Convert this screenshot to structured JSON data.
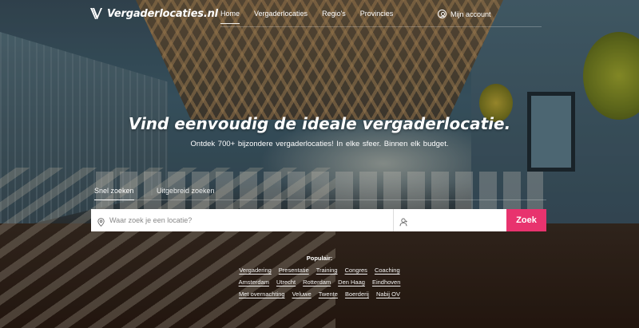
{
  "header": {
    "logo_text": "Vergaderlocaties.nl",
    "nav": [
      "Home",
      "Vergaderlocaties",
      "Regio's",
      "Provincies"
    ],
    "account_label": "Mijn account"
  },
  "hero": {
    "headline": "Vind eenvoudig de ideale vergaderlocatie.",
    "subline": "Ontdek 700+ bijzondere vergaderlocaties!  In elke sfeer.  Binnen elk budget."
  },
  "search": {
    "tabs": [
      "Snel zoeken",
      "Uitgebreid zoeken"
    ],
    "placeholder": "Waar zoek je een locatie?",
    "button_label": "Zoek",
    "accent_color": "#e8336e"
  },
  "popular": {
    "title": "Populair:",
    "rows": [
      [
        "Vergadering",
        "Presentatie",
        "Training",
        "Congres",
        "Coaching"
      ],
      [
        "Amsterdam",
        "Utrecht",
        "Rotterdam",
        "Den Haag",
        "Eindhoven"
      ],
      [
        "Met overnachting",
        "Veluwe",
        "Twente",
        "Boerderij",
        "Nabij OV"
      ]
    ]
  }
}
